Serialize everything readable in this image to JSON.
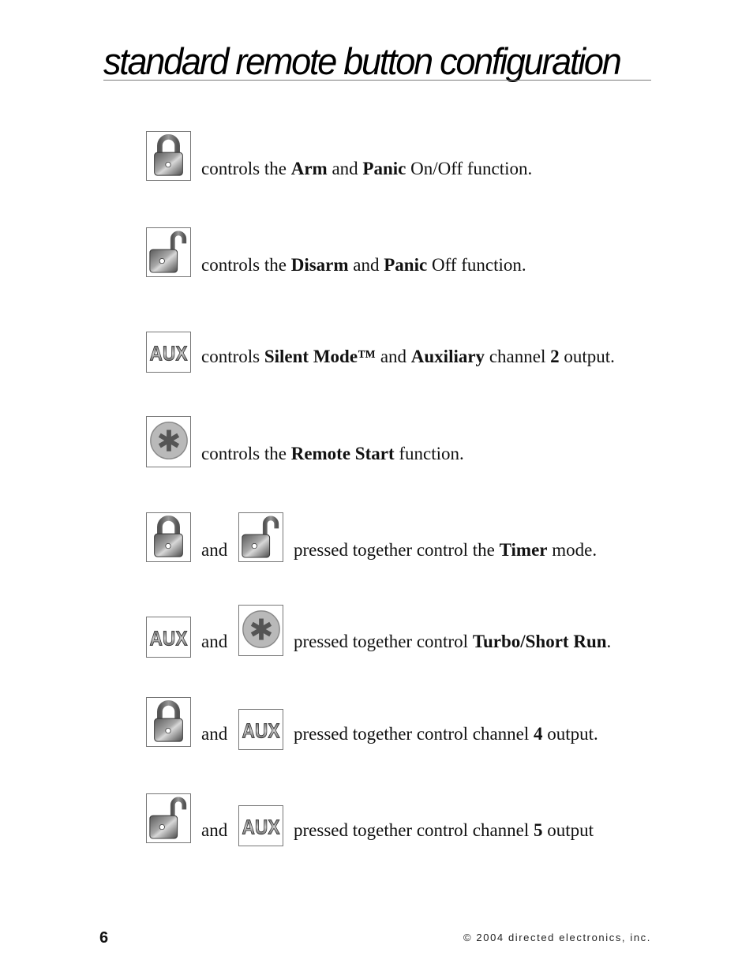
{
  "page": {
    "title": "standard remote button configuration",
    "page_number": "6",
    "copyright": "© 2004 directed electronics, inc."
  },
  "icons": {
    "lock": "lock-icon",
    "unlock": "unlock-icon",
    "aux": "aux-icon",
    "star": "asterisk-icon"
  },
  "aux_label": "AUX",
  "rows": [
    {
      "buttons": [
        "lock"
      ],
      "parts": [
        "controls the ",
        "Arm",
        " and ",
        "Panic",
        " On/Off function."
      ]
    },
    {
      "buttons": [
        "unlock"
      ],
      "parts": [
        "controls the ",
        "Disarm",
        " and ",
        "Panic",
        " Off function."
      ]
    },
    {
      "buttons": [
        "aux"
      ],
      "parts": [
        "controls ",
        "Silent Mode™",
        " and ",
        "Auxiliary",
        " channel ",
        "2",
        " output."
      ]
    },
    {
      "buttons": [
        "star"
      ],
      "parts": [
        "controls the ",
        "Remote Start",
        " function."
      ]
    },
    {
      "buttons": [
        "lock",
        "unlock"
      ],
      "joiner": "and",
      "parts": [
        "pressed together control the ",
        "Timer",
        " mode."
      ]
    },
    {
      "buttons": [
        "aux",
        "star"
      ],
      "joiner": "and",
      "parts": [
        "pressed together control ",
        "Turbo/Short Run",
        "."
      ]
    },
    {
      "buttons": [
        "lock",
        "aux"
      ],
      "joiner": "and",
      "parts": [
        "pressed together control channel ",
        "4",
        " output."
      ]
    },
    {
      "buttons": [
        "unlock",
        "aux"
      ],
      "joiner": "and",
      "parts": [
        "pressed together control channel ",
        "5",
        " output"
      ]
    }
  ]
}
